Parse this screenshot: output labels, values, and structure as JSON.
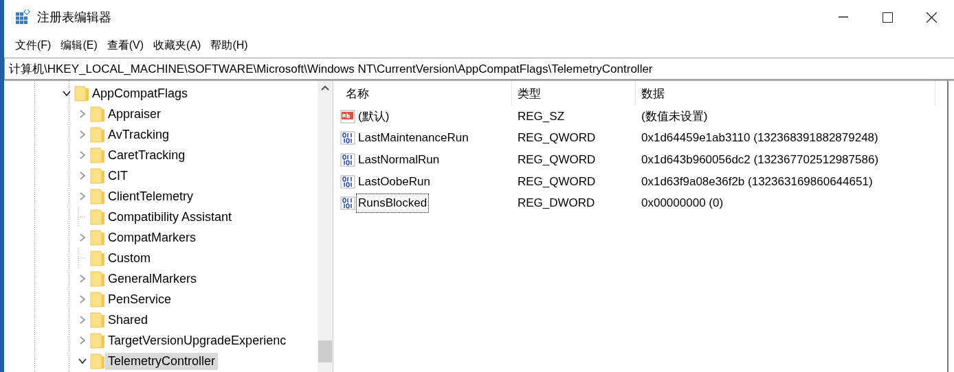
{
  "window": {
    "title": "注册表编辑器"
  },
  "menu": [
    "文件(F)",
    "编辑(E)",
    "查看(V)",
    "收藏夹(A)",
    "帮助(H)"
  ],
  "address": "计算机\\HKEY_LOCAL_MACHINE\\SOFTWARE\\Microsoft\\Windows NT\\CurrentVersion\\AppCompatFlags\\TelemetryController",
  "tree": [
    {
      "label": "AppCompatFlags",
      "expandable": true,
      "expanded": true,
      "selected": false,
      "children": [
        {
          "label": "Appraiser",
          "expandable": true,
          "expanded": false,
          "selected": false
        },
        {
          "label": "AvTracking",
          "expandable": true,
          "expanded": false,
          "selected": false
        },
        {
          "label": "CaretTracking",
          "expandable": true,
          "expanded": false,
          "selected": false
        },
        {
          "label": "CIT",
          "expandable": true,
          "expanded": false,
          "selected": false
        },
        {
          "label": "ClientTelemetry",
          "expandable": true,
          "expanded": false,
          "selected": false
        },
        {
          "label": "Compatibility Assistant",
          "expandable": false,
          "expanded": false,
          "selected": false
        },
        {
          "label": "CompatMarkers",
          "expandable": true,
          "expanded": false,
          "selected": false
        },
        {
          "label": "Custom",
          "expandable": false,
          "expanded": false,
          "selected": false
        },
        {
          "label": "GeneralMarkers",
          "expandable": true,
          "expanded": false,
          "selected": false
        },
        {
          "label": "PenService",
          "expandable": true,
          "expanded": false,
          "selected": false
        },
        {
          "label": "Shared",
          "expandable": true,
          "expanded": false,
          "selected": false
        },
        {
          "label": "TargetVersionUpgradeExperienc",
          "expandable": true,
          "expanded": false,
          "selected": false
        },
        {
          "label": "TelemetryController",
          "expandable": true,
          "expanded": true,
          "selected": true
        }
      ]
    }
  ],
  "table": {
    "columns": [
      "名称",
      "类型",
      "数据"
    ],
    "rows": [
      {
        "kind": "string",
        "name": "(默认)",
        "type": "REG_SZ",
        "data": "(数值未设置)",
        "focused": false
      },
      {
        "kind": "binary",
        "name": "LastMaintenanceRun",
        "type": "REG_QWORD",
        "data": "0x1d64459e1ab3110 (132368391882879248)",
        "focused": false
      },
      {
        "kind": "binary",
        "name": "LastNormalRun",
        "type": "REG_QWORD",
        "data": "0x1d643b960056dc2 (132367702512987586)",
        "focused": false
      },
      {
        "kind": "binary",
        "name": "LastOobeRun",
        "type": "REG_QWORD",
        "data": "0x1d63f9a08e36f2b (132363169860644651)",
        "focused": false
      },
      {
        "kind": "binary",
        "name": "RunsBlocked",
        "type": "REG_DWORD",
        "data": "0x00000000 (0)",
        "focused": true
      }
    ]
  }
}
